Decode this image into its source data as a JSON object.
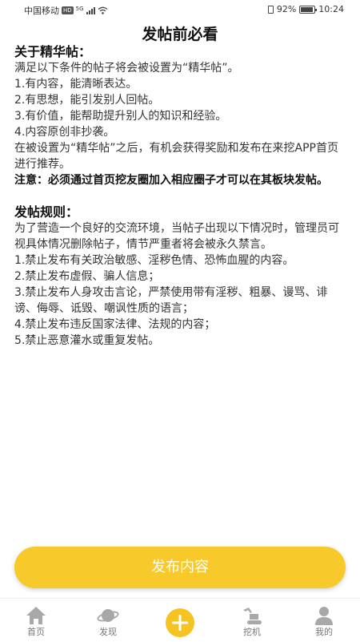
{
  "status_bar": {
    "carrier": "中国移动",
    "hd_badge": "HD",
    "network_badge": "5G",
    "battery_percent": "92%",
    "time": "10:24"
  },
  "page": {
    "title": "发帖前必看"
  },
  "featured": {
    "heading": "关于精华帖：",
    "intro": "满足以下条件的帖子将会被设置为“精华帖”。",
    "items": [
      "1.有内容，能清晰表达。",
      "2.有思想，能引发别人回帖。",
      "3.有价值，能帮助提升别人的知识和经验。",
      "4.内容原创非抄袭。"
    ],
    "reward": "在被设置为“精华帖”之后，有机会获得奖励和发布在来挖APP首页进行推荐。",
    "note": "注意：必须通过首页挖友圈加入相应圈子才可以在其板块发帖。"
  },
  "rules": {
    "heading": "发帖规则：",
    "intro": "为了营造一个良好的交流环境，当帖子出现以下情况时，管理员可视具体情况删除帖子，情节严重者将会被永久禁言。",
    "items": [
      "1.禁止发布有关政治敏感、淫秽色情、恐怖血腥的内容。",
      "2.禁止发布虚假、骗人信息；",
      "3.禁止发布人身攻击言论，严禁使用带有淫秽、粗暴、谩骂、诽谤、侮辱、诋毁、嘲讽性质的语言；",
      "4.禁止发布违反国家法律、法规的内容；",
      "5.禁止恶意灌水或重复发帖。"
    ]
  },
  "action": {
    "publish_label": "发布内容"
  },
  "tab_bar": {
    "items": [
      {
        "label": "首页",
        "icon": "home-icon"
      },
      {
        "label": "发现",
        "icon": "planet-icon"
      },
      {
        "label": "",
        "icon": "plus-icon"
      },
      {
        "label": "挖机",
        "icon": "excavator-icon"
      },
      {
        "label": "我的",
        "icon": "user-icon"
      }
    ]
  },
  "colors": {
    "accent": "#F7C92A",
    "tab_icon": "#A8A8A8",
    "tab_label": "#777777"
  }
}
